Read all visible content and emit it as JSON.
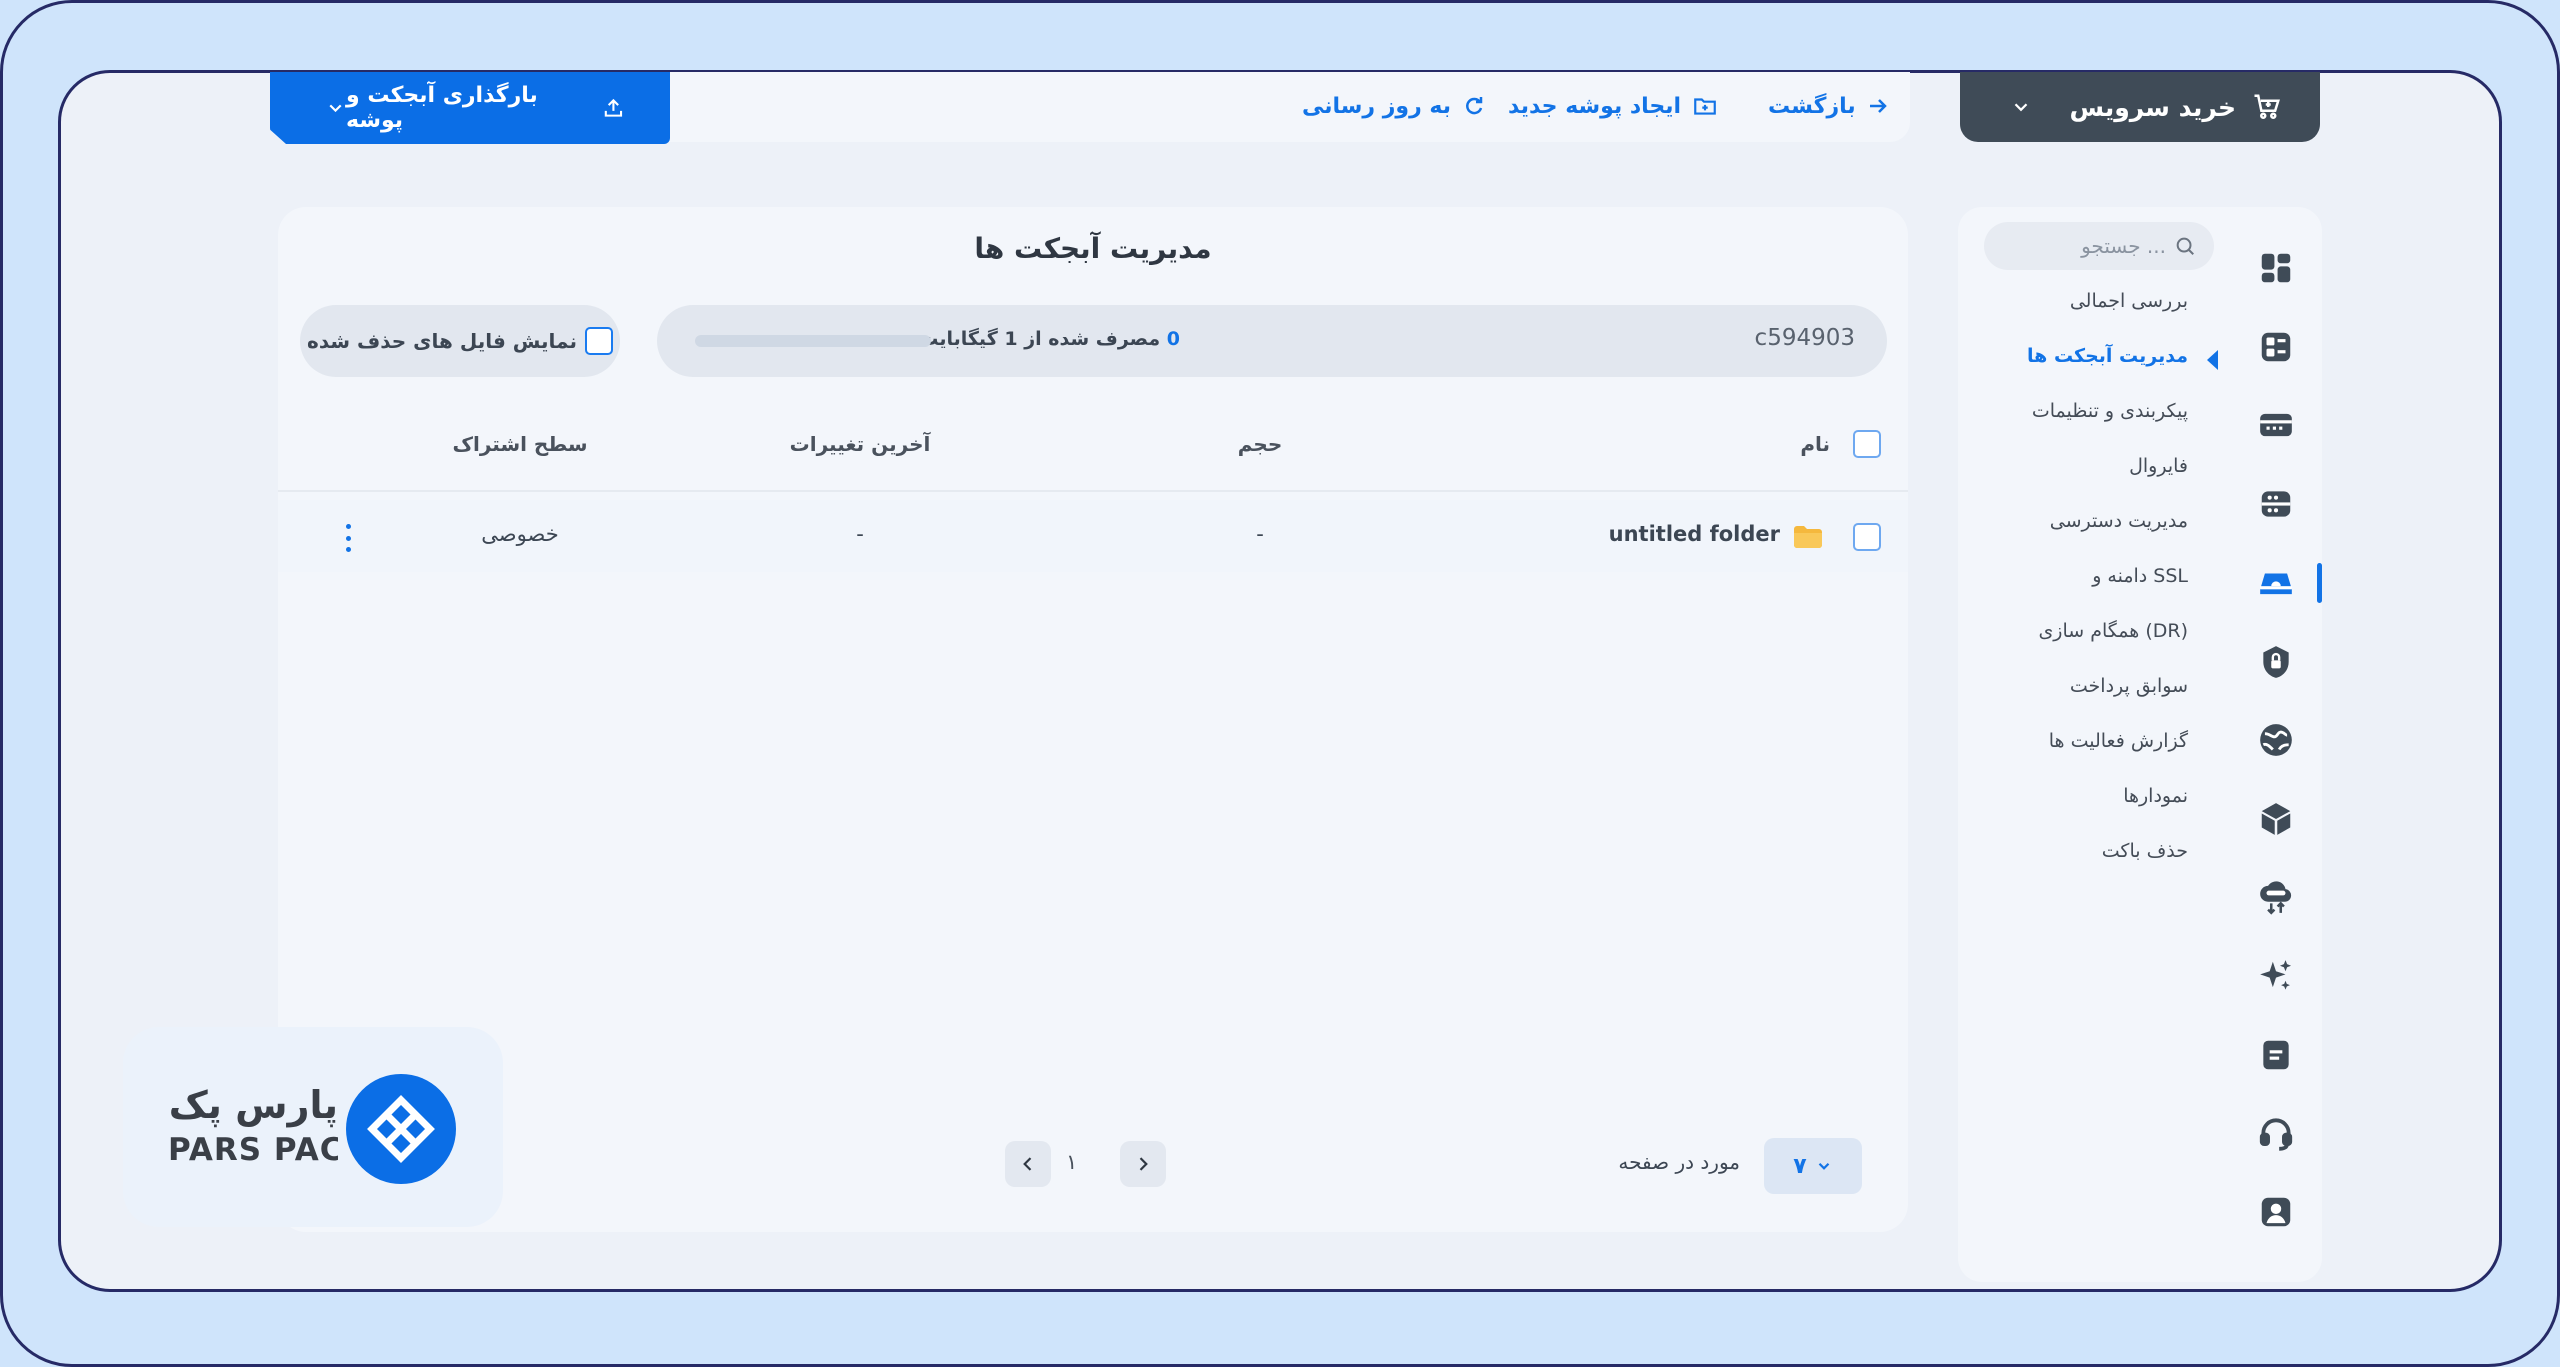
{
  "header": {
    "buy_service": "خرید سرویس",
    "back": "بازگشت",
    "new_folder": "ایجاد پوشه جدید",
    "refresh": "به روز رسانی",
    "upload": "بارگذاری آبجکت و پوشه"
  },
  "sidebar": {
    "search_placeholder": "جستجو ...",
    "items": [
      {
        "label": "بررسی اجمالی",
        "active": false
      },
      {
        "label": "مدیریت آبجکت ها",
        "active": true
      },
      {
        "label": "پیکربندی و تنظیمات",
        "active": false
      },
      {
        "label": "فایروال",
        "active": false
      },
      {
        "label": "مدیریت دسترسی",
        "active": false
      },
      {
        "label": "دامنه و SSL",
        "active": false
      },
      {
        "label": "همگام سازی (DR)",
        "active": false
      },
      {
        "label": "سوابق پرداخت",
        "active": false
      },
      {
        "label": "گزارش فعالیت ها",
        "active": false
      },
      {
        "label": "نمودارها",
        "active": false
      },
      {
        "label": "حذف باکت",
        "active": false
      }
    ],
    "rail_icons": [
      "dashboard-icon",
      "object-icon",
      "server-icon",
      "database-icon",
      "cloud-storage-icon",
      "lock-icon",
      "globe-icon",
      "box-icon",
      "cloud-sync-icon",
      "sparkle-icon",
      "document-icon",
      "headset-icon",
      "user-icon"
    ]
  },
  "main": {
    "title": "مدیریت آبجکت ها",
    "bucket_name": "c594903",
    "usage_value": "0",
    "usage_text": "مصرف شده از 1 گیگابایت",
    "usage_fraction": 0,
    "show_deleted": "نمایش فایل های حذف شده",
    "columns": {
      "name": "نام",
      "size": "حجم",
      "modified": "آخرین تغییرات",
      "access": "سطح اشتراک"
    },
    "rows": [
      {
        "name": "untitled folder",
        "size": "-",
        "modified": "-",
        "access": "خصوصی"
      }
    ],
    "pagination": {
      "current_page": "۱",
      "per_page_label": "مورد در صفحه",
      "per_page_value": "۷"
    }
  },
  "logo": {
    "text_fa": "پارس پک",
    "text_en": "PARS PACK"
  },
  "colors": {
    "accent": "#1273e6",
    "dark_button": "#3f4b57",
    "frame_border": "#262a66",
    "background": "#cfe4fb"
  }
}
